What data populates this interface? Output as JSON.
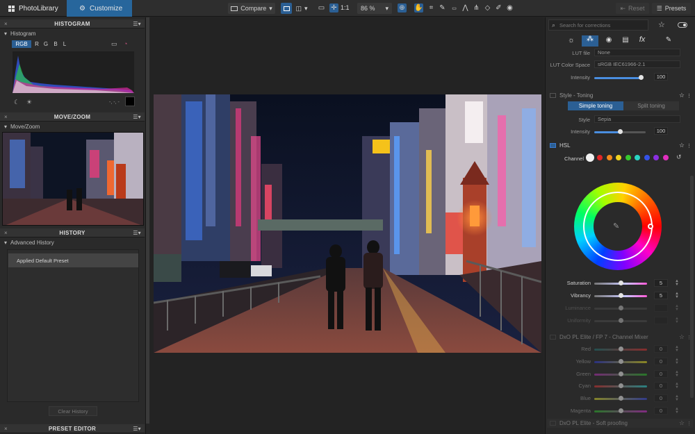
{
  "topbar": {
    "tabs": [
      {
        "label": "PhotoLibrary",
        "icon": "grid-icon"
      },
      {
        "label": "Customize",
        "icon": "sliders-icon"
      }
    ],
    "compare_label": "Compare",
    "ratio_label": "1:1",
    "zoom_value": "86 %",
    "reset_label": "Reset",
    "presets_label": "Presets"
  },
  "left": {
    "histogram": {
      "title": "HISTOGRAM",
      "sub": "Histogram",
      "channels": [
        "RGB",
        "R",
        "G",
        "B",
        "L"
      ],
      "active_channel": "RGB",
      "readout": "-, -, -"
    },
    "movezoom": {
      "title": "MOVE/ZOOM",
      "sub": "Move/Zoom"
    },
    "history": {
      "title": "HISTORY",
      "sub": "Advanced History",
      "items": [
        "Applied Default Preset"
      ],
      "clear_label": "Clear History"
    },
    "preset_editor": {
      "title": "PRESET EDITOR"
    }
  },
  "right": {
    "search_placeholder": "Search for corrections",
    "lut": {
      "file_label": "LUT file",
      "file_value": "None",
      "space_label": "LUT Color Space",
      "space_value": "sRGB IEC61966-2.1",
      "intensity_label": "Intensity",
      "intensity_value": "100",
      "intensity_level": 0.97
    },
    "toning": {
      "title": "Style - Toning",
      "tabs": [
        "Simple toning",
        "Split toning"
      ],
      "active_tab": "Simple toning",
      "style_label": "Style",
      "style_value": "Sepia",
      "intensity_label": "Intensity",
      "intensity_value": "100",
      "intensity_level": 0.5
    },
    "hsl": {
      "title": "HSL",
      "channel_label": "Channel",
      "swatches": [
        "#f2f2f2",
        "#e22626",
        "#f28a1c",
        "#efd21f",
        "#37c82e",
        "#2ad4c3",
        "#3552e8",
        "#8a2fe0",
        "#e02fbe"
      ],
      "sliders": [
        {
          "label": "Saturation",
          "value": "5",
          "level": 0.5,
          "enabled": true
        },
        {
          "label": "Vibrancy",
          "value": "5",
          "level": 0.5,
          "enabled": true
        },
        {
          "label": "Luminance",
          "value": "",
          "level": 0.5,
          "enabled": false
        },
        {
          "label": "Uniformity",
          "value": "",
          "level": 0.5,
          "enabled": false
        }
      ]
    },
    "mixer": {
      "title": "DxO PL Elite / FP 7 - Channel Mixer",
      "rows": [
        {
          "label": "Red",
          "value": "0",
          "grad": "linear-gradient(90deg,#1e7070,#d23030)"
        },
        {
          "label": "Yellow",
          "value": "0",
          "grad": "linear-gradient(90deg,#2b37c8,#d9d21e)"
        },
        {
          "label": "Green",
          "value": "0",
          "grad": "linear-gradient(90deg,#b02cb0,#28b428)"
        },
        {
          "label": "Cyan",
          "value": "0",
          "grad": "linear-gradient(90deg,#d03030,#2ac8c8)"
        },
        {
          "label": "Blue",
          "value": "0",
          "grad": "linear-gradient(90deg,#cfcf2a,#3a4ad8)"
        },
        {
          "label": "Magenta",
          "value": "0",
          "grad": "linear-gradient(90deg,#2ab42a,#c82cc8)"
        }
      ],
      "level": 0.5
    },
    "soft_proofing": {
      "title": "DxO PL Elite - Soft proofing"
    }
  },
  "colors": {
    "accent": "#2b5f94",
    "panel": "#2a2a2a",
    "background": "#232323"
  }
}
